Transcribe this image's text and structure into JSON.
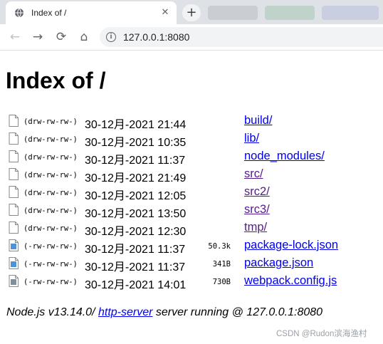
{
  "browser": {
    "tab_title": "Index of /",
    "new_tab_symbol": "+",
    "close_symbol": "✕",
    "url": "127.0.0.1:8080",
    "icons": {
      "favicon": "globe-icon",
      "back": "back-arrow-icon",
      "forward": "forward-arrow-icon",
      "reload": "reload-icon",
      "home": "home-icon",
      "site_info": "info-icon"
    }
  },
  "page": {
    "title": "Index of /",
    "entries": [
      {
        "perms": "(drw-rw-rw-)",
        "mtime": "30-12月-2021 21:44",
        "size": "",
        "name": "build/",
        "icon": "folder-file-icon",
        "visited": false
      },
      {
        "perms": "(drw-rw-rw-)",
        "mtime": "30-12月-2021 10:35",
        "size": "",
        "name": "lib/",
        "icon": "folder-file-icon",
        "visited": false
      },
      {
        "perms": "(drw-rw-rw-)",
        "mtime": "30-12月-2021 11:37",
        "size": "",
        "name": "node_modules/",
        "icon": "folder-file-icon",
        "visited": false
      },
      {
        "perms": "(drw-rw-rw-)",
        "mtime": "30-12月-2021 21:49",
        "size": "",
        "name": "src/",
        "icon": "folder-file-icon",
        "visited": true
      },
      {
        "perms": "(drw-rw-rw-)",
        "mtime": "30-12月-2021 12:05",
        "size": "",
        "name": "src2/",
        "icon": "folder-file-icon",
        "visited": true
      },
      {
        "perms": "(drw-rw-rw-)",
        "mtime": "30-12月-2021 13:50",
        "size": "",
        "name": "src3/",
        "icon": "folder-file-icon",
        "visited": true
      },
      {
        "perms": "(drw-rw-rw-)",
        "mtime": "30-12月-2021 12:30",
        "size": "",
        "name": "tmp/",
        "icon": "folder-file-icon",
        "visited": true
      },
      {
        "perms": "(-rw-rw-rw-)",
        "mtime": "30-12月-2021 11:37",
        "size": "50.3k",
        "name": "package-lock.json",
        "icon": "json-file-icon",
        "visited": false
      },
      {
        "perms": "(-rw-rw-rw-)",
        "mtime": "30-12月-2021 11:37",
        "size": "341B",
        "name": "package.json",
        "icon": "json-file-icon",
        "visited": false
      },
      {
        "perms": "(-rw-rw-rw-)",
        "mtime": "30-12月-2021 14:01",
        "size": "730B",
        "name": "webpack.config.js",
        "icon": "js-file-icon",
        "visited": false
      }
    ],
    "footer": {
      "prefix": "Node.js v13.14.0/ ",
      "link_text": "http-server",
      "suffix": " server running @ 127.0.0.1:8080"
    }
  },
  "watermark": "CSDN @Rudon滨海渔村",
  "colors": {
    "link": "#0000ee",
    "visited_link": "#551a8b",
    "tabstrip": "#dee1e6"
  }
}
